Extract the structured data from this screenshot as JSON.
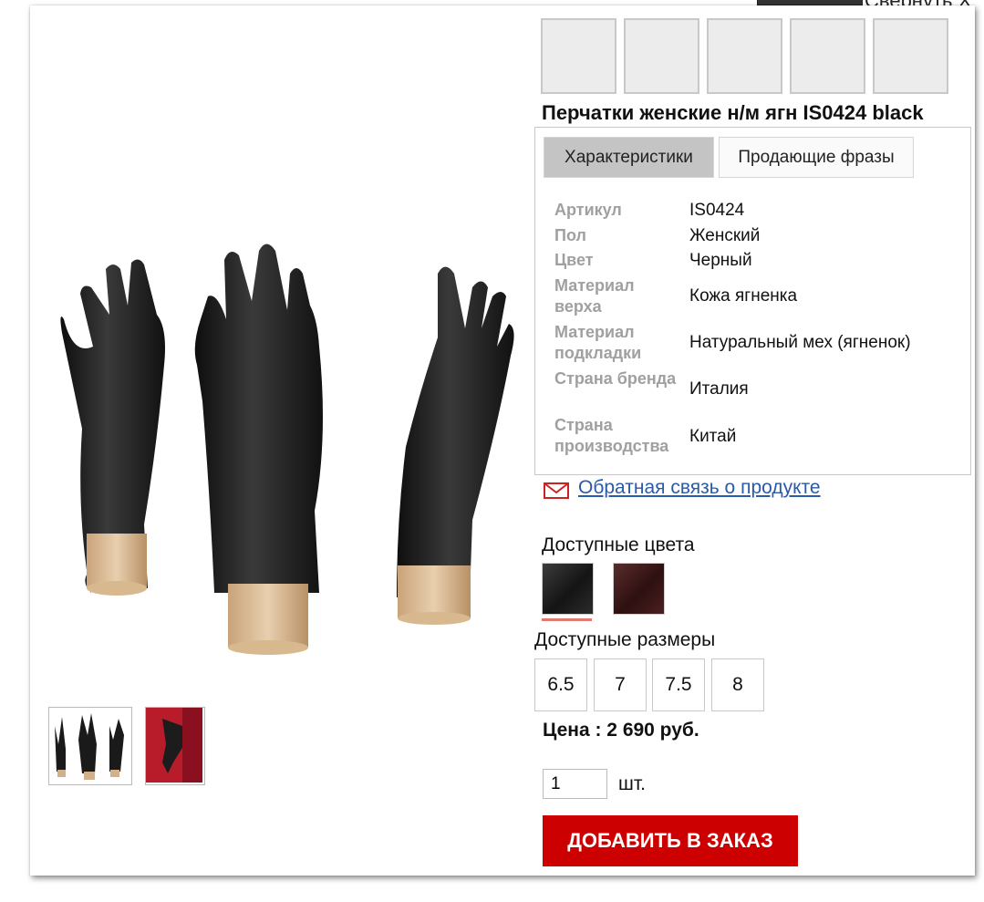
{
  "header": {
    "collapse_label": "Свернуть X"
  },
  "product": {
    "title": "Перчатки женские н/м ягн IS0424 black"
  },
  "tabs": [
    {
      "label": "Характеристики",
      "active": true
    },
    {
      "label": "Продающие фразы",
      "active": false
    }
  ],
  "specs": [
    {
      "label": "Артикул",
      "value": "IS0424"
    },
    {
      "label": "Пол",
      "value": "Женский"
    },
    {
      "label": "Цвет",
      "value": "Черный"
    },
    {
      "label": "Материал верха",
      "value": "Кожа ягненка"
    },
    {
      "label": "Материал подкладки",
      "value": "Натуральный мех (ягненок)"
    },
    {
      "label": "Страна бренда",
      "value": "Италия"
    },
    {
      "label": "Страна производства",
      "value": "Китай"
    }
  ],
  "feedback": {
    "link_text": "Обратная связь о продукте",
    "accent": "#cc2222"
  },
  "colors": {
    "label": "Доступные цвета",
    "options": [
      {
        "name": "black",
        "hex": "#1c1c1c"
      },
      {
        "name": "brown",
        "hex": "#3e1818"
      }
    ]
  },
  "sizes": {
    "label": "Доступные размеры",
    "options": [
      "6.5",
      "7",
      "7.5",
      "8"
    ]
  },
  "price": {
    "text": "Цена : 2 690 руб."
  },
  "quantity": {
    "value": "1",
    "unit": "шт."
  },
  "order_button": {
    "label": "ДОБАВИТЬ В ЗАКАЗ",
    "color": "#cc0000"
  }
}
